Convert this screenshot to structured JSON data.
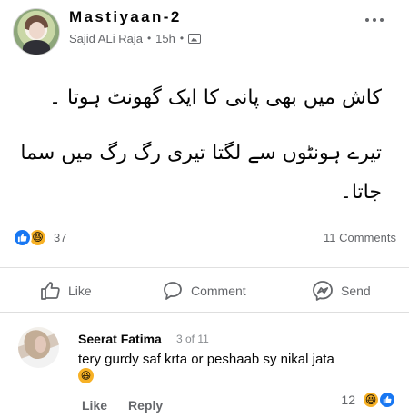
{
  "post": {
    "group_name": "Mastiyaan-2",
    "author": "Sajid ALi Raja",
    "time": "15h",
    "separator": "•",
    "more_icon": "more-horizontal-icon",
    "privacy_icon": "photo-privacy-icon",
    "text_line_1": "کاش میں بھی پانی کا ایک گھونٹ ہوتا ۔",
    "text_line_2": "تیرے ہونٹوں سے لگتا تیری رگ رگ میں سما",
    "text_line_3": "جاتا۔"
  },
  "reactions": {
    "count": "37",
    "comments": "11 Comments",
    "types": [
      "like-reaction-icon",
      "haha-reaction-icon"
    ],
    "like_color": "#1877f2",
    "haha_color": "#f7b125"
  },
  "actions": {
    "like": "Like",
    "comment": "Comment",
    "send": "Send"
  },
  "comment": {
    "author": "Seerat Fatima",
    "index": "3 of 11",
    "text": "tery gurdy saf krta or peshaab sy nikal jata",
    "emoji_icon": "laughing-emoji-icon",
    "like": "Like",
    "reply": "Reply",
    "reaction_count": "12"
  }
}
